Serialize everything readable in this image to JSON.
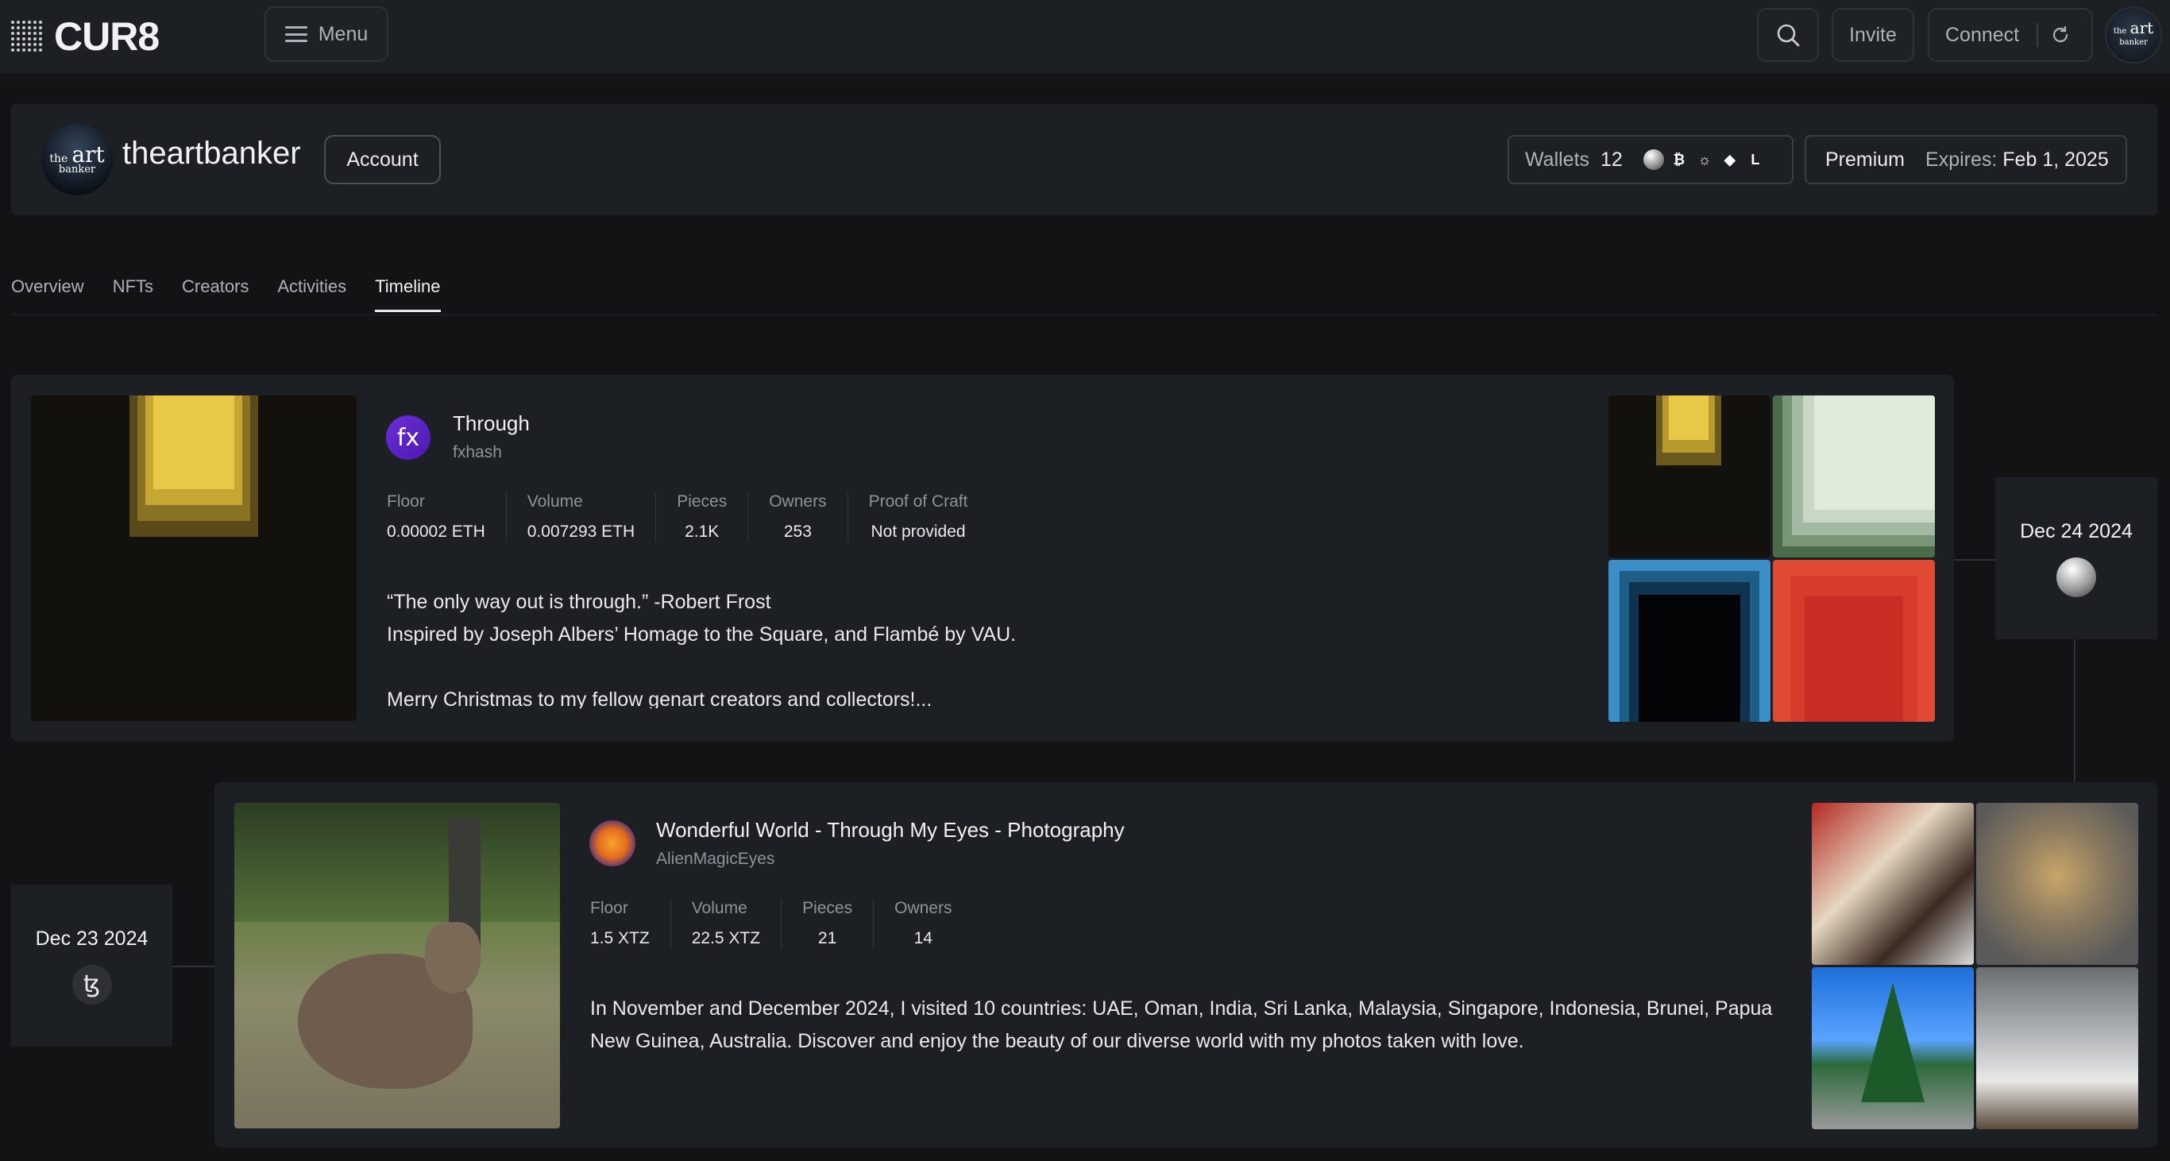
{
  "app": {
    "logo": "CUR8"
  },
  "topbar": {
    "menu_label": "Menu",
    "invite_label": "Invite",
    "connect_label": "Connect"
  },
  "profile": {
    "avatar_text_top": "the",
    "avatar_text_main": "art",
    "avatar_text_bottom": "banker",
    "username": "theartbanker",
    "account_label": "Account",
    "wallets_label": "Wallets",
    "wallets_count": "12",
    "chain_icons": [
      "sphere-icon",
      "bitcoin-icon",
      "sun-icon",
      "ethereum-icon",
      "l-chain-icon"
    ],
    "premium_label": "Premium",
    "expires_label": "Expires:",
    "expires_date": "Feb 1, 2025"
  },
  "tabs": [
    {
      "label": "Overview",
      "active": false
    },
    {
      "label": "NFTs",
      "active": false
    },
    {
      "label": "Creators",
      "active": false
    },
    {
      "label": "Activities",
      "active": false
    },
    {
      "label": "Timeline",
      "active": true
    }
  ],
  "timeline": [
    {
      "date": "Dec 24 2024",
      "chain_icon": "sphere-icon",
      "platform_badge": "fx",
      "title": "Through",
      "platform": "fxhash",
      "stats": [
        {
          "label": "Floor",
          "value": "0.00002 ETH"
        },
        {
          "label": "Volume",
          "value": "0.007293 ETH"
        },
        {
          "label": "Pieces",
          "value": "2.1K"
        },
        {
          "label": "Owners",
          "value": "253"
        },
        {
          "label": "Proof of Craft",
          "value": "Not provided"
        }
      ],
      "description_lines": [
        "“The only way out is through.” -Robert Frost",
        "Inspired by Joseph Albers’ Homage to the Square, and Flambé by VAU.",
        "",
        "Merry Christmas to my fellow genart creators and collectors!..."
      ]
    },
    {
      "date": "Dec 23 2024",
      "chain_icon": "tezos-icon",
      "chain_glyph": "ꜩ",
      "title": "Wonderful World - Through My Eyes - Photography",
      "platform": "AlienMagicEyes",
      "stats": [
        {
          "label": "Floor",
          "value": "1.5 XTZ"
        },
        {
          "label": "Volume",
          "value": "22.5 XTZ"
        },
        {
          "label": "Pieces",
          "value": "21"
        },
        {
          "label": "Owners",
          "value": "14"
        }
      ],
      "description_lines": [
        "In November and December 2024, I visited 10 countries: UAE, Oman, India, Sri Lanka, Malaysia, Singapore, Indonesia, Brunei, Papua",
        "New Guinea, Australia. Discover and enjoy the beauty of our diverse world with my photos taken with love."
      ]
    }
  ]
}
